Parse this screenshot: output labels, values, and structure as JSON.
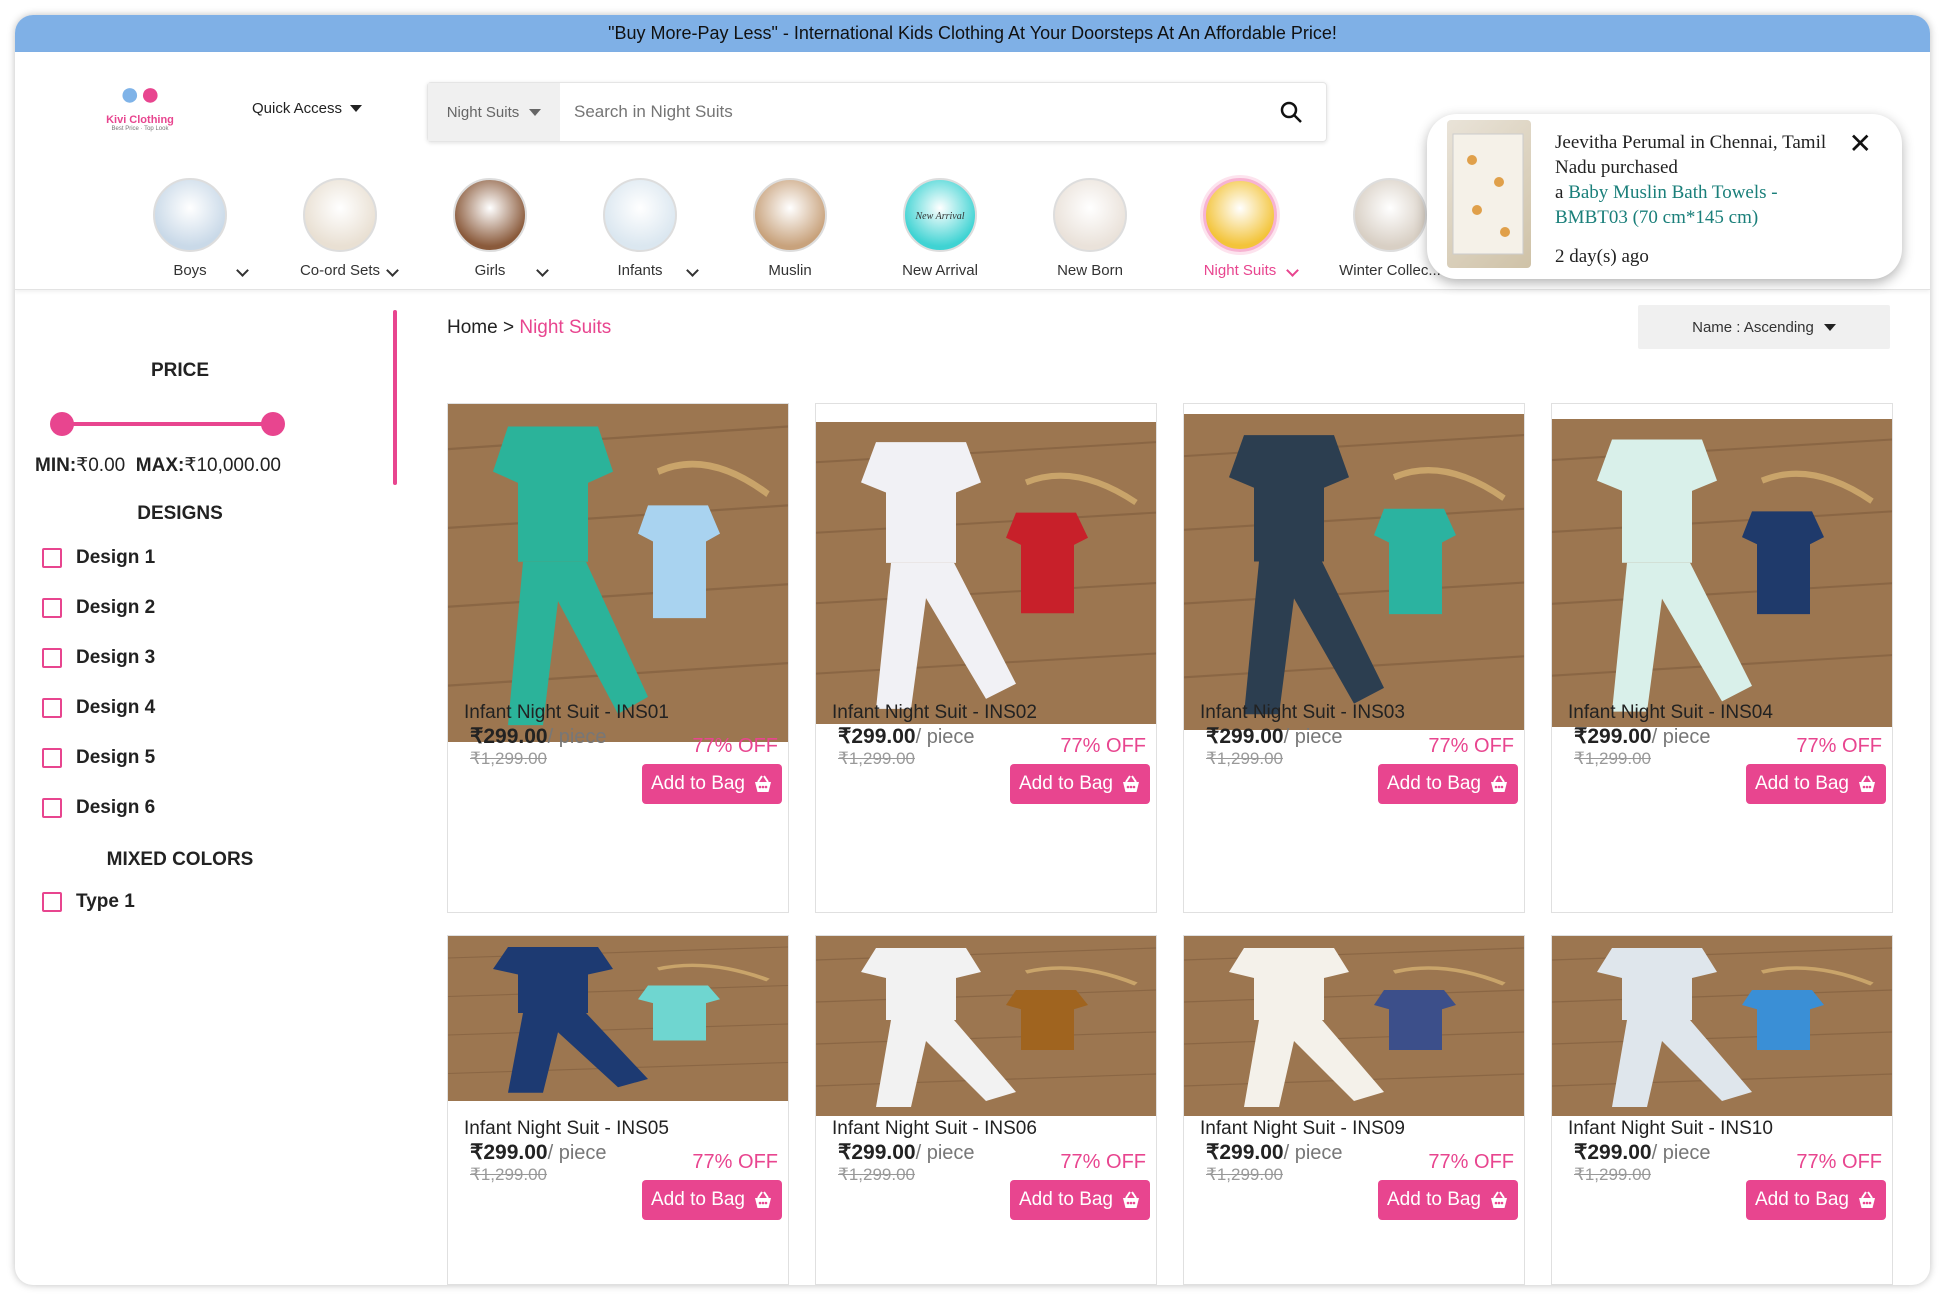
{
  "promo": "\"Buy More-Pay Less\" - International Kids Clothing At Your Doorsteps At An Affordable Price!",
  "brand": {
    "name": "Kivi Clothing",
    "tagline": "Best Price · Top Look"
  },
  "quick_access": "Quick Access",
  "search": {
    "category": "Night Suits",
    "placeholder": "Search in Night Suits"
  },
  "categories": [
    {
      "label": "Boys",
      "has_menu": true
    },
    {
      "label": "Co-ord Sets",
      "has_menu": true
    },
    {
      "label": "Girls",
      "has_menu": true
    },
    {
      "label": "Infants",
      "has_menu": true
    },
    {
      "label": "Muslin",
      "has_menu": false
    },
    {
      "label": "New Arrival",
      "has_menu": false,
      "badge_text": "New Arrival"
    },
    {
      "label": "New Born",
      "has_menu": false
    },
    {
      "label": "Night Suits",
      "has_menu": true,
      "active": true
    },
    {
      "label": "Winter Collec...",
      "has_menu": false
    }
  ],
  "toast": {
    "line1": "Jeevitha Perumal in Chennai, Tamil Nadu purchased",
    "prefix": "a",
    "product": "Baby Muslin Bath Towels - BMBT03 (70 cm*145 cm)",
    "time": "2 day(s) ago",
    "close": "✕"
  },
  "filters": {
    "price_heading": "PRICE",
    "min_label": "MIN:",
    "min_value": "₹0.00",
    "max_label": "MAX:",
    "max_value": "₹10,000.00",
    "designs_heading": "DESIGNS",
    "designs": [
      "Design 1",
      "Design 2",
      "Design 3",
      "Design 4",
      "Design 5",
      "Design 6"
    ],
    "mixed_heading": "MIXED COLORS",
    "mixed": [
      "Type 1"
    ]
  },
  "breadcrumb": {
    "home": "Home",
    "sep": ">",
    "current": "Night Suits"
  },
  "sort": "Name : Ascending",
  "products": [
    {
      "name": "Infant Night Suit - INS01",
      "price": "₹299.00",
      "unit": "/ piece",
      "mrp": "₹1,299.00",
      "off": "77% OFF",
      "cta": "Add to Bag",
      "colors": [
        "#2bb39a",
        "#a9d3f0"
      ]
    },
    {
      "name": "Infant Night Suit - INS02",
      "price": "₹299.00",
      "unit": "/ piece",
      "mrp": "₹1,299.00",
      "off": "77% OFF",
      "cta": "Add to Bag",
      "colors": [
        "#f1f1f5",
        "#c8202a"
      ]
    },
    {
      "name": "Infant Night Suit - INS03",
      "price": "₹299.00",
      "unit": "/ piece",
      "mrp": "₹1,299.00",
      "off": "77% OFF",
      "cta": "Add to Bag",
      "colors": [
        "#2c3e50",
        "#2bb3a0"
      ]
    },
    {
      "name": "Infant Night Suit - INS04",
      "price": "₹299.00",
      "unit": "/ piece",
      "mrp": "₹1,299.00",
      "off": "77% OFF",
      "cta": "Add to Bag",
      "colors": [
        "#d9f0ea",
        "#1f3a6b"
      ]
    },
    {
      "name": "Infant Night Suit - INS05",
      "price": "₹299.00",
      "unit": "/ piece",
      "mrp": "₹1,299.00",
      "off": "77% OFF",
      "cta": "Add to Bag",
      "colors": [
        "#1d3a72",
        "#6fd6d0"
      ]
    },
    {
      "name": "Infant Night Suit - INS06",
      "price": "₹299.00",
      "unit": "/ piece",
      "mrp": "₹1,299.00",
      "off": "77% OFF",
      "cta": "Add to Bag",
      "colors": [
        "#f2f2f2",
        "#a0641f"
      ]
    },
    {
      "name": "Infant Night Suit - INS09",
      "price": "₹299.00",
      "unit": "/ piece",
      "mrp": "₹1,299.00",
      "off": "77% OFF",
      "cta": "Add to Bag",
      "colors": [
        "#f4f1ea",
        "#3c4f8a"
      ]
    },
    {
      "name": "Infant Night Suit - INS10",
      "price": "₹299.00",
      "unit": "/ piece",
      "mrp": "₹1,299.00",
      "off": "77% OFF",
      "cta": "Add to Bag",
      "colors": [
        "#dfe6ec",
        "#3a8fd6"
      ]
    }
  ],
  "theme": {
    "accent": "#e8458f",
    "promo_bg": "#7fb0e6"
  }
}
